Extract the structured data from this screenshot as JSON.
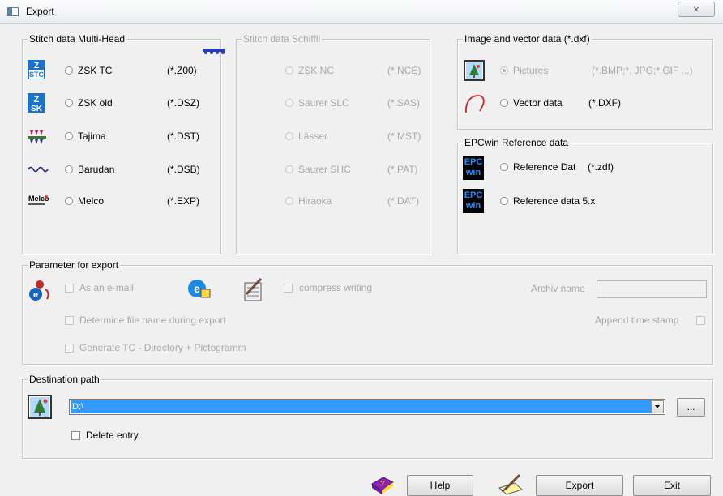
{
  "window": {
    "title": "Export",
    "close_label": "⨯",
    "border_color": "#c9cfd6"
  },
  "stitch_multi": {
    "legend": "Stitch data Multi-Head",
    "items": [
      {
        "label": "ZSK TC",
        "ext": "(*.Z00)",
        "icon": "zsk-tc-logo-icon"
      },
      {
        "label": "ZSK old",
        "ext": "(*.DSZ)",
        "icon": "zsk-logo-icon"
      },
      {
        "label": "Tajima",
        "ext": "(*.DST)",
        "icon": "tajima-logo-icon"
      },
      {
        "label": "Barudan",
        "ext": "(*.DSB)",
        "icon": "barudan-logo-icon"
      },
      {
        "label": "Melco",
        "ext": "(*.EXP)",
        "icon": "melco-logo-icon"
      }
    ]
  },
  "stitch_schiffli": {
    "legend": "Stitch data Schiffli",
    "items": [
      {
        "label": "ZSK NC",
        "ext": "(*.NCE)"
      },
      {
        "label": "Saurer SLC",
        "ext": "(*.SAS)"
      },
      {
        "label": "Lässer",
        "ext": "(*.MST)"
      },
      {
        "label": "Saurer SHC",
        "ext": "(*.PAT)"
      },
      {
        "label": "Hiraoka",
        "ext": "(*.DAT)"
      }
    ]
  },
  "image_vector": {
    "legend": "Image  and vector data (*.dxf)",
    "pictures_label": "Pictures",
    "pictures_ext": "(*.BMP;*. JPG;*.GIF ...)",
    "vector_label": "Vector data",
    "vector_ext": "(*.DXF)"
  },
  "epcwin": {
    "legend": "EPCwin Reference data",
    "icon_text_top": "EPC",
    "icon_text_bottom": "win",
    "ref_dat_label": "Reference Dat",
    "ref_dat_ext": "(*.zdf)",
    "ref_5x_label": "Reference data 5.x"
  },
  "params": {
    "legend": "Parameter for export",
    "email_label": "As an e-mail",
    "compress_label": "compress writing",
    "archiv_label": "Archiv name",
    "archiv_value": "",
    "determine_label": "Determine file name during export",
    "append_label": "Append time stamp",
    "generate_label": "Generate TC - Directory + Pictogramm"
  },
  "destination": {
    "legend": "Destination path",
    "path_value": "D:\\",
    "browse_label": "...",
    "delete_label": "Delete entry"
  },
  "buttons": {
    "help": "Help",
    "export": "Export",
    "exit": "Exit"
  },
  "colors": {
    "accent": "#3399ff",
    "disabled_text": "#a8a8a8",
    "epc_blue": "#1e90ff"
  }
}
